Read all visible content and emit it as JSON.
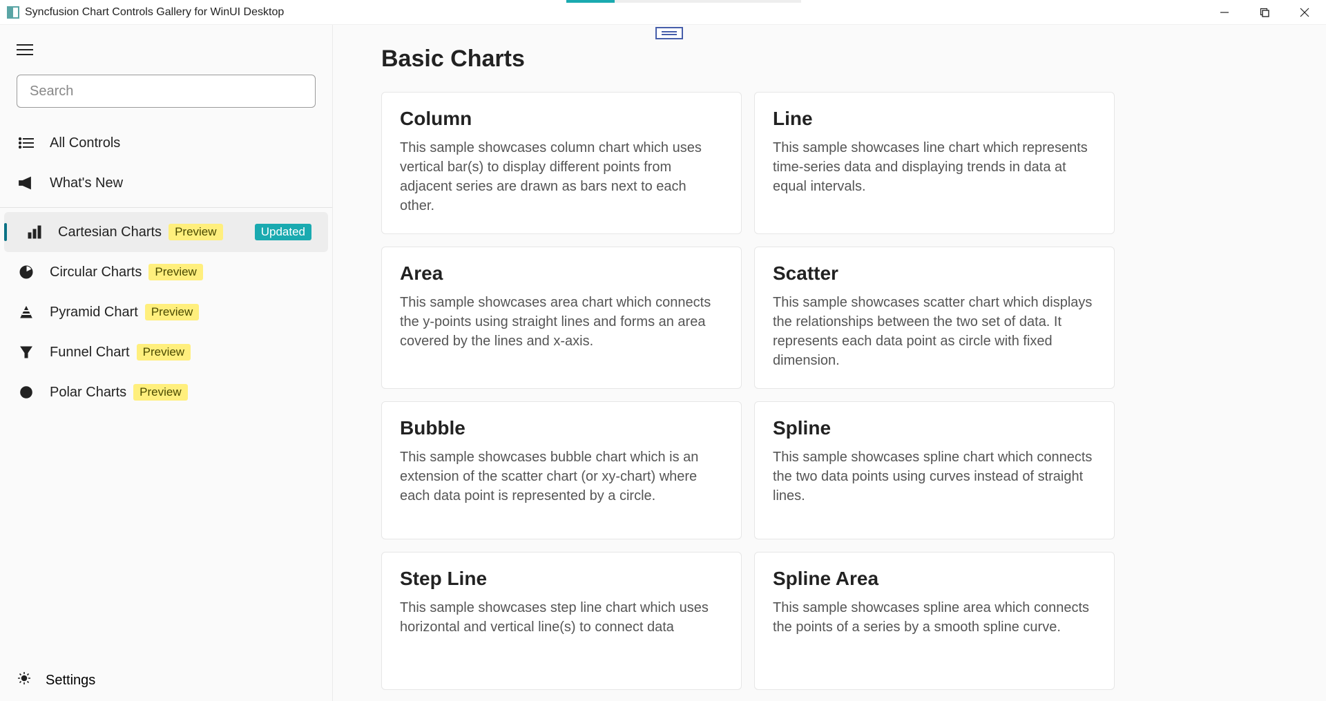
{
  "window": {
    "title": "Syncfusion Chart Controls Gallery for WinUI Desktop"
  },
  "search": {
    "placeholder": "Search"
  },
  "nav": {
    "allControls": "All Controls",
    "whatsNew": "What's New"
  },
  "badges": {
    "preview": "Preview",
    "updated": "Updated"
  },
  "chartNav": [
    {
      "label": "Cartesian Charts",
      "preview": true,
      "updated": true,
      "active": true
    },
    {
      "label": "Circular Charts",
      "preview": true,
      "updated": false,
      "active": false
    },
    {
      "label": "Pyramid Chart",
      "preview": true,
      "updated": false,
      "active": false
    },
    {
      "label": "Funnel Chart",
      "preview": true,
      "updated": false,
      "active": false
    },
    {
      "label": "Polar Charts",
      "preview": true,
      "updated": false,
      "active": false
    }
  ],
  "settings": "Settings",
  "page": {
    "title": "Basic Charts"
  },
  "cards": [
    {
      "title": "Column",
      "desc": "This sample showcases column chart which uses vertical bar(s) to display different points from adjacent series are drawn as bars next to each other."
    },
    {
      "title": "Line",
      "desc": "This sample showcases line chart which represents time-series data and displaying trends in data at equal intervals."
    },
    {
      "title": "Area",
      "desc": "This sample showcases area chart which connects the y-points using straight lines and forms an area covered by the lines and x-axis."
    },
    {
      "title": "Scatter",
      "desc": "This sample showcases scatter chart which displays the relationships between the two set of data. It represents each data point as circle with fixed dimension."
    },
    {
      "title": "Bubble",
      "desc": "This sample showcases bubble chart which is an extension of the scatter chart (or xy-chart) where each data point is represented by a circle."
    },
    {
      "title": "Spline",
      "desc": "This sample showcases spline chart which connects the two data points using curves instead of straight lines."
    },
    {
      "title": "Step Line",
      "desc": "This sample showcases step line chart which uses horizontal and vertical line(s) to connect data"
    },
    {
      "title": "Spline Area",
      "desc": "This sample showcases spline area which connects the points of a series by a smooth spline curve."
    }
  ]
}
